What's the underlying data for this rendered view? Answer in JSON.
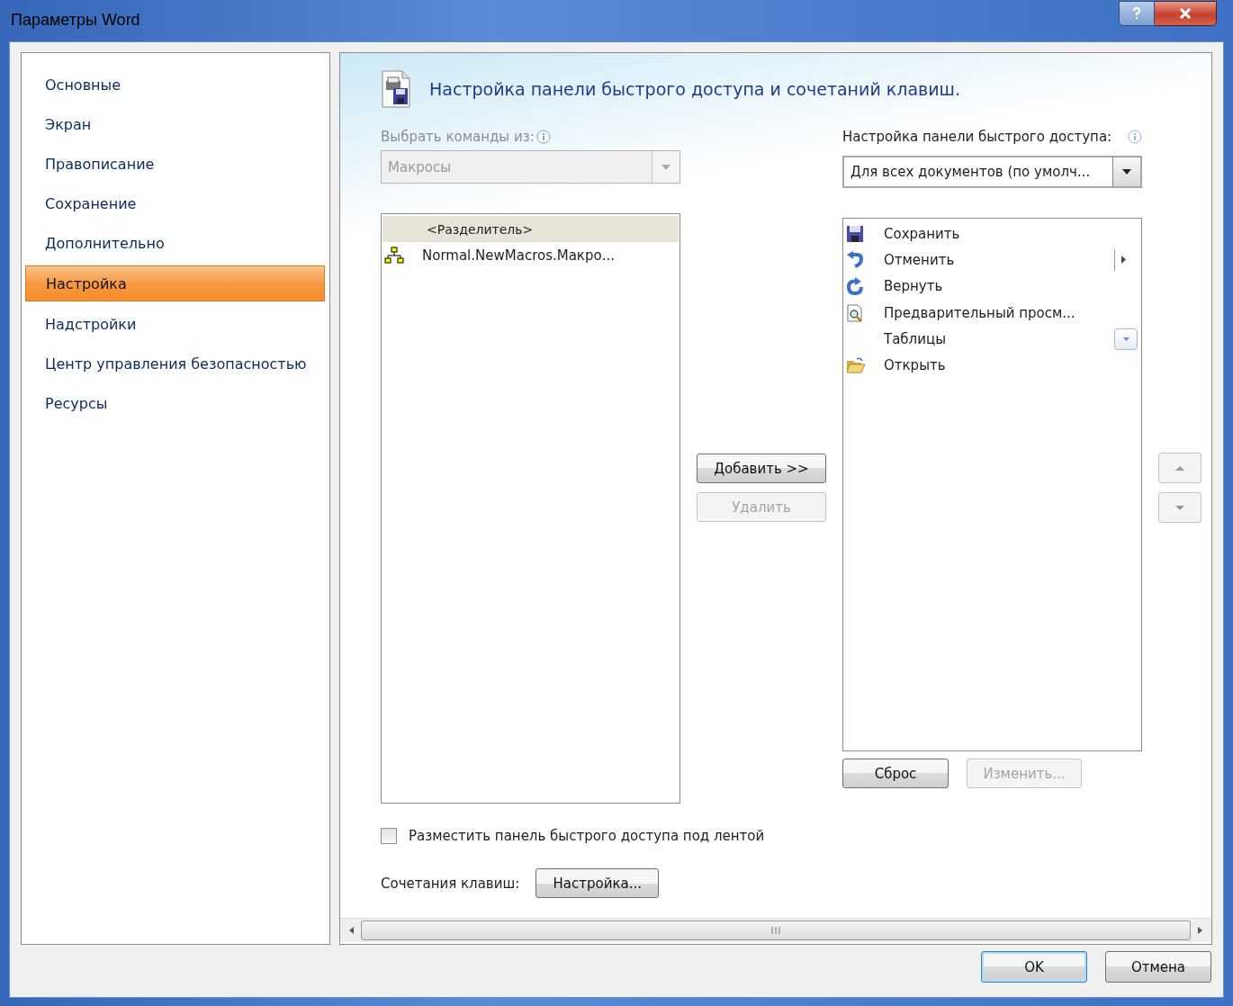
{
  "window": {
    "title": "Параметры Word"
  },
  "sidebar": {
    "items": [
      {
        "label": "Основные",
        "selected": false
      },
      {
        "label": "Экран",
        "selected": false
      },
      {
        "label": "Правописание",
        "selected": false
      },
      {
        "label": "Сохранение",
        "selected": false
      },
      {
        "label": "Дополнительно",
        "selected": false
      },
      {
        "label": "Настройка",
        "selected": true
      },
      {
        "label": "Надстройки",
        "selected": false
      },
      {
        "label": "Центр управления безопасностью",
        "selected": false
      },
      {
        "label": "Ресурсы",
        "selected": false
      }
    ]
  },
  "header": {
    "title": "Настройка панели быстрого доступа и сочетаний клавиш."
  },
  "commands": {
    "label": "Выбрать команды из:",
    "dropdown": {
      "value": "Макросы",
      "disabled": true
    },
    "items": [
      {
        "label": "<Разделитель>",
        "kind": "separator",
        "selected": true
      },
      {
        "label": "Normal.NewMacros.Макро...",
        "kind": "macro",
        "selected": false
      }
    ]
  },
  "add_button": {
    "label": "Добавить >>",
    "disabled": false
  },
  "remove_button": {
    "label": "Удалить",
    "disabled": true
  },
  "toolbar": {
    "label": "Настройка панели быстрого доступа:",
    "dropdown": {
      "value": "Для всех документов (по умолч...",
      "disabled": false
    },
    "items": [
      {
        "label": "Сохранить",
        "kind": "save",
        "has_submenu": false,
        "has_menu_button": false
      },
      {
        "label": "Отменить",
        "kind": "undo",
        "has_submenu": true,
        "has_menu_button": false
      },
      {
        "label": "Вернуть",
        "kind": "redo",
        "has_submenu": false,
        "has_menu_button": false
      },
      {
        "label": "Предварительный просм...",
        "kind": "preview",
        "has_submenu": false,
        "has_menu_button": false
      },
      {
        "label": "Таблицы",
        "kind": "plain",
        "has_submenu": false,
        "has_menu_button": true
      },
      {
        "label": "Открыть",
        "kind": "open",
        "has_submenu": false,
        "has_menu_button": false
      }
    ]
  },
  "reset_button": {
    "label": "Сброс",
    "disabled": false
  },
  "modify_button": {
    "label": "Изменить...",
    "disabled": true
  },
  "move_up_button": {
    "disabled": true
  },
  "move_down_button": {
    "disabled": true
  },
  "below_ribbon": {
    "label": "Разместить панель быстрого доступа под лентой",
    "checked": false
  },
  "shortcuts": {
    "label": "Сочетания клавиш:",
    "button": "Настройка..."
  },
  "buttons": [
    {
      "label": "OK",
      "default": true
    },
    {
      "label": "Отмена",
      "default": false
    }
  ]
}
